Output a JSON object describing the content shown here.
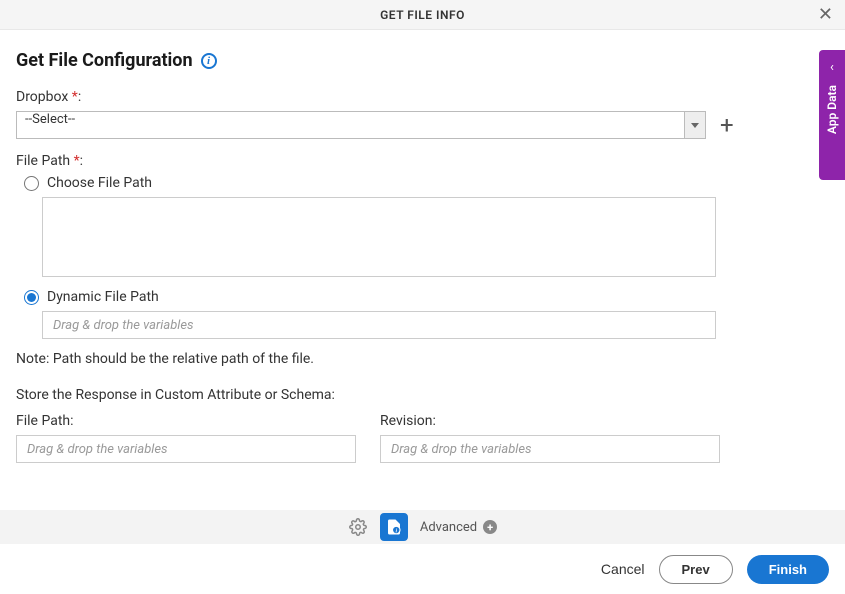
{
  "header": {
    "title": "GET FILE INFO"
  },
  "page": {
    "title": "Get File Configuration"
  },
  "fields": {
    "dropbox": {
      "label": "Dropbox",
      "required": "*",
      "value": "--Select--"
    },
    "filePath": {
      "label": "File Path",
      "required": "*",
      "options": {
        "choose": "Choose File Path",
        "dynamic": "Dynamic File Path"
      },
      "dynamicPlaceholder": "Drag & drop the variables",
      "note": "Note: Path should be the relative path of the file."
    },
    "storeResponse": {
      "label": "Store the Response in Custom Attribute or Schema:",
      "filePath": {
        "label": "File Path:",
        "placeholder": "Drag & drop the variables"
      },
      "revision": {
        "label": "Revision:",
        "placeholder": "Drag & drop the variables"
      }
    }
  },
  "bottomBar": {
    "advanced": "Advanced"
  },
  "footer": {
    "cancel": "Cancel",
    "prev": "Prev",
    "finish": "Finish"
  },
  "sideTab": {
    "label": "App Data"
  }
}
